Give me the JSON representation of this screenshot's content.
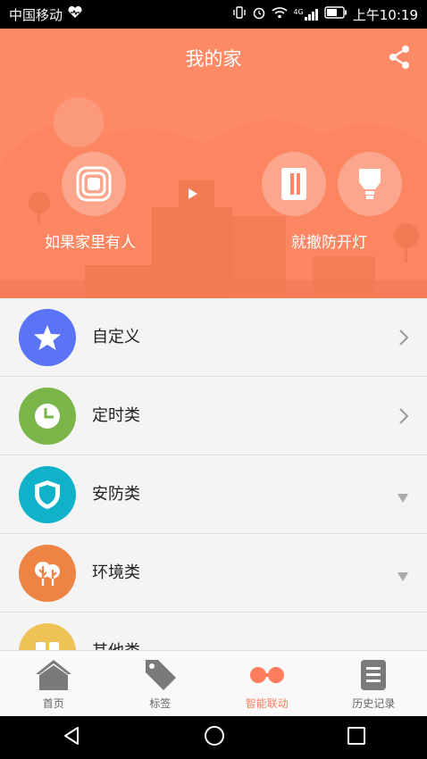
{
  "status": {
    "carrier": "中国移动",
    "network": "4G",
    "time": "上午10:19"
  },
  "header": {
    "title": "我的家"
  },
  "hero": {
    "left_label": "如果家里有人",
    "right_label": "就撤防开灯"
  },
  "list": [
    {
      "label": "自定义",
      "icon": "star-icon",
      "color": "#5b73f5",
      "indicator": "chevron"
    },
    {
      "label": "定时类",
      "icon": "clock-icon",
      "color": "#79b548",
      "indicator": "chevron"
    },
    {
      "label": "安防类",
      "icon": "shield-icon",
      "color": "#10b2c9",
      "indicator": "triangle"
    },
    {
      "label": "环境类",
      "icon": "tree-icon",
      "color": "#ee8444",
      "indicator": "triangle"
    },
    {
      "label": "其他类",
      "icon": "other-icon",
      "color": "#efc255",
      "indicator": "none"
    }
  ],
  "tabs": [
    {
      "label": "首页",
      "icon": "home-icon"
    },
    {
      "label": "标签",
      "icon": "tag-icon"
    },
    {
      "label": "智能联动",
      "icon": "link-icon",
      "active": true
    },
    {
      "label": "历史记录",
      "icon": "history-icon"
    }
  ],
  "colors": {
    "accent": "#ff8a65",
    "active_tab": "#ff7e5f"
  }
}
